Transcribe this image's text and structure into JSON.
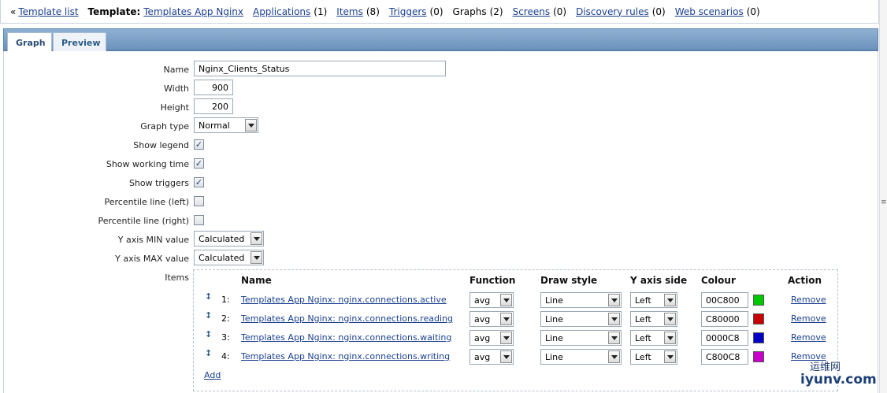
{
  "nav": {
    "back_link": "Template list",
    "template_label": "Template:",
    "template_name": "Templates App Nginx",
    "links": [
      {
        "label": "Applications",
        "count": "(1)"
      },
      {
        "label": "Items",
        "count": "(8)"
      },
      {
        "label": "Triggers",
        "count": "(0)"
      },
      {
        "label": "Graphs",
        "count": "(2)"
      },
      {
        "label": "Screens",
        "count": "(0)"
      },
      {
        "label": "Discovery rules",
        "count": "(0)"
      },
      {
        "label": "Web scenarios",
        "count": "(0)"
      }
    ]
  },
  "tabs": [
    "Graph",
    "Preview"
  ],
  "form": {
    "name_label": "Name",
    "name_value": "Nginx_Clients_Status",
    "width_label": "Width",
    "width_value": "900",
    "height_label": "Height",
    "height_value": "200",
    "graph_type_label": "Graph type",
    "graph_type_value": "Normal",
    "show_legend_label": "Show legend",
    "show_working_time_label": "Show working time",
    "show_triggers_label": "Show triggers",
    "percentile_left_label": "Percentile line (left)",
    "percentile_right_label": "Percentile line (right)",
    "ymin_label": "Y axis MIN value",
    "ymin_value": "Calculated",
    "ymax_label": "Y axis MAX value",
    "ymax_value": "Calculated",
    "items_label": "Items"
  },
  "checks": {
    "show_legend": true,
    "show_working_time": true,
    "show_triggers": true,
    "percentile_left": false,
    "percentile_right": false
  },
  "items_table": {
    "headers": [
      "Name",
      "Function",
      "Draw style",
      "Y axis side",
      "Colour",
      "Action"
    ],
    "rows": [
      {
        "index": "1:",
        "name": "Templates App Nginx: nginx.connections.active",
        "function": "avg",
        "draw_style": "Line",
        "y_axis": "Left",
        "colour": "00C800",
        "swatch": "#00c800",
        "action": "Remove"
      },
      {
        "index": "2:",
        "name": "Templates App Nginx: nginx.connections.reading",
        "function": "avg",
        "draw_style": "Line",
        "y_axis": "Left",
        "colour": "C80000",
        "swatch": "#c80000",
        "action": "Remove"
      },
      {
        "index": "3:",
        "name": "Templates App Nginx: nginx.connections.waiting",
        "function": "avg",
        "draw_style": "Line",
        "y_axis": "Left",
        "colour": "0000C8",
        "swatch": "#0000c8",
        "action": "Remove"
      },
      {
        "index": "4:",
        "name": "Templates App Nginx: nginx.connections.writing",
        "function": "avg",
        "draw_style": "Line",
        "y_axis": "Left",
        "colour": "C800C8",
        "swatch": "#c800c8",
        "action": "Remove"
      }
    ],
    "add_label": "Add"
  },
  "watermark": {
    "line1": "运维网",
    "line2": "iyunv.com"
  }
}
